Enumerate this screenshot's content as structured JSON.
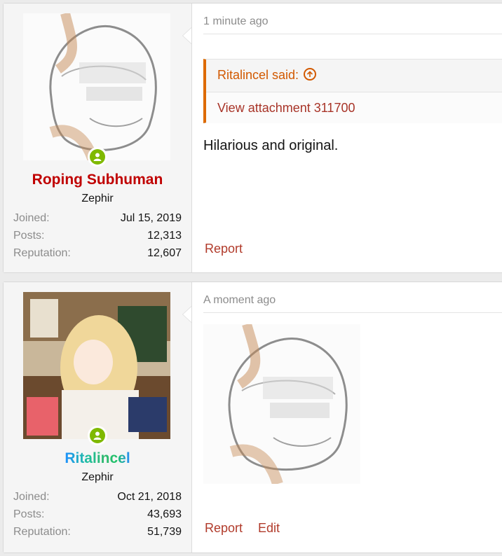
{
  "posts": [
    {
      "user": {
        "name": "Roping Subhuman",
        "title": "Zephir",
        "stats": [
          {
            "label": "Joined:",
            "value": "Jul 15, 2019"
          },
          {
            "label": "Posts:",
            "value": "12,313"
          },
          {
            "label": "Reputation:",
            "value": "12,607"
          }
        ]
      },
      "date": "1 minute ago",
      "quote": {
        "author_line": "Ritalincel said:",
        "body": "View attachment 311700"
      },
      "text": "Hilarious and original.",
      "actions": {
        "report": "Report"
      }
    },
    {
      "user": {
        "name": "Ritalincel",
        "title": "Zephir",
        "stats": [
          {
            "label": "Joined:",
            "value": "Oct 21, 2018"
          },
          {
            "label": "Posts:",
            "value": "43,693"
          },
          {
            "label": "Reputation:",
            "value": "51,739"
          }
        ]
      },
      "date": "A moment ago",
      "actions": {
        "report": "Report",
        "edit": "Edit"
      }
    }
  ],
  "colors": {
    "username_red": "#c00000",
    "link": "#b13b2b",
    "quote_accent": "#dd6a00",
    "online": "#7fb900"
  }
}
